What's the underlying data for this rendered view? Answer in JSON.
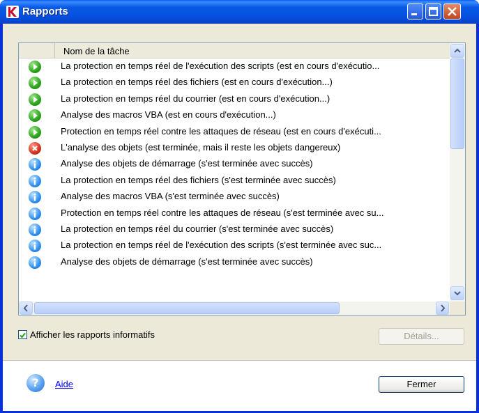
{
  "window": {
    "title": "Rapports",
    "app_icon": "kaspersky-k-icon",
    "controls": [
      "minimize-icon",
      "maximize-icon",
      "close-icon"
    ]
  },
  "list": {
    "column_header": "Nom de la tâche",
    "rows": [
      {
        "status": "running",
        "icon": "play-icon",
        "text": "La protection en temps réel de l'exécution des scripts (est en cours d'exécutio..."
      },
      {
        "status": "running",
        "icon": "play-icon",
        "text": "La protection en temps réel des fichiers (est en cours d'exécution...)"
      },
      {
        "status": "running",
        "icon": "play-icon",
        "text": "La protection en temps réel du courrier (est en cours d'exécution...)"
      },
      {
        "status": "running",
        "icon": "play-icon",
        "text": "Analyse des macros VBA (est en cours d'exécution...)"
      },
      {
        "status": "running",
        "icon": "play-icon",
        "text": "Protection en temps réel contre les attaques de réseau (est en cours d'exécuti..."
      },
      {
        "status": "error",
        "icon": "error-icon",
        "text": "L'analyse des objets (est terminée, mais il reste les objets dangereux)"
      },
      {
        "status": "info",
        "icon": "info-icon",
        "text": "Analyse des objets de démarrage (s'est terminée avec succès)"
      },
      {
        "status": "info",
        "icon": "info-icon",
        "text": "La protection en temps réel des fichiers (s'est terminée avec succès)"
      },
      {
        "status": "info",
        "icon": "info-icon",
        "text": "Analyse des macros VBA (s'est terminée avec succès)"
      },
      {
        "status": "info",
        "icon": "info-icon",
        "text": "Protection en temps réel contre les attaques de réseau (s'est terminée avec su..."
      },
      {
        "status": "info",
        "icon": "info-icon",
        "text": "La protection en temps réel du courrier (s'est terminée avec succès)"
      },
      {
        "status": "info",
        "icon": "info-icon",
        "text": "La protection en temps réel de l'exécution des scripts (s'est terminée avec suc..."
      },
      {
        "status": "info",
        "icon": "info-icon",
        "text": "Analyse des objets de démarrage (s'est terminée avec succès)"
      }
    ]
  },
  "options": {
    "show_info_reports_label": "Afficher les rapports informatifs",
    "show_info_reports_checked": true
  },
  "buttons": {
    "details_label": "Détails...",
    "close_label": "Fermer"
  },
  "help": {
    "label": "Aide"
  },
  "colors": {
    "titlebar": "#0a5ae6",
    "running": "#2ba31a",
    "error": "#d4321c",
    "info": "#2f8ff0"
  }
}
